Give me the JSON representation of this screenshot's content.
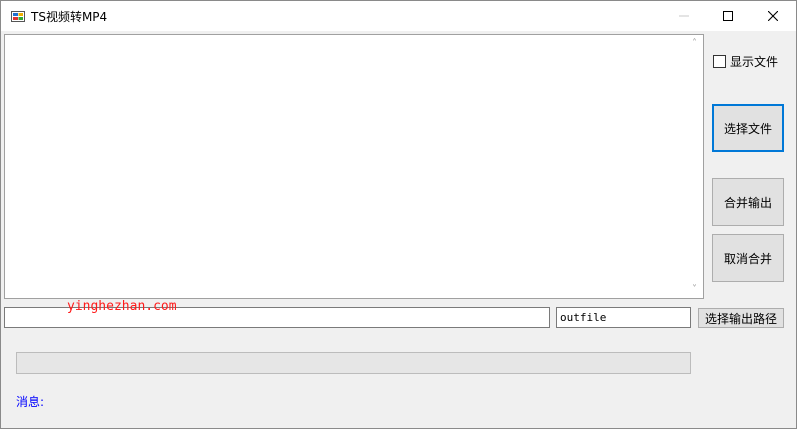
{
  "window": {
    "title": "TS视频转MP4",
    "icons": {
      "app": "app-icon",
      "minimize": "minimize-icon",
      "maximize": "maximize-icon",
      "close": "close-icon"
    }
  },
  "log": {
    "content": ""
  },
  "show_files": {
    "label": "显示文件",
    "checked": false
  },
  "buttons": {
    "select_file": "选择文件",
    "merge_output": "合并输出",
    "cancel_merge": "取消合并",
    "select_output_path": "选择输出路径"
  },
  "path_input": {
    "value": ""
  },
  "outfile_input": {
    "value": "outfile"
  },
  "watermark": "yinghezhan.com",
  "progress": {
    "fraction": 0
  },
  "message": {
    "label": "消息:"
  },
  "colors": {
    "accent": "#0078d7",
    "message": "#0000ff",
    "watermark": "#ff1a1a"
  }
}
